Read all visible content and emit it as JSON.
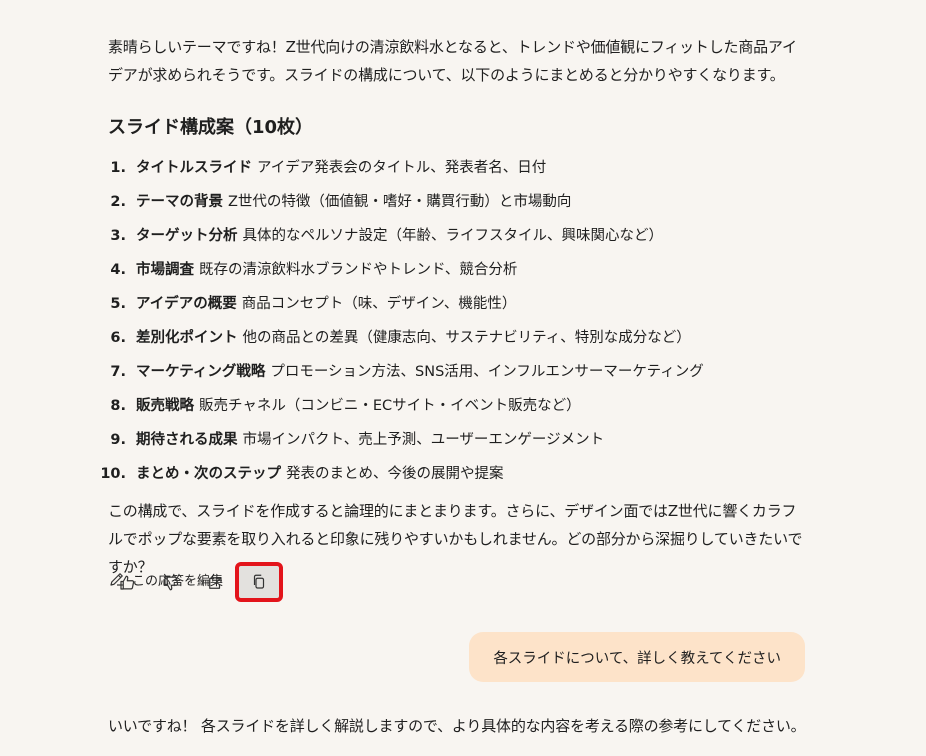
{
  "assistant_message": {
    "intro": "素晴らしいテーマですね！Z世代向けの清涼飲料水となると、トレンドや価値観にフィットした商品アイデアが求められそうです。スライドの構成について、以下のようにまとめると分かりやすくなります。",
    "heading": "スライド構成案（10枚）",
    "slides": [
      {
        "num": "1.",
        "title": "タイトルスライド",
        "desc": "アイデア発表会のタイトル、発表者名、日付"
      },
      {
        "num": "2.",
        "title": "テーマの背景",
        "desc": "Z世代の特徴（価値観・嗜好・購買行動）と市場動向"
      },
      {
        "num": "3.",
        "title": "ターゲット分析",
        "desc": "具体的なペルソナ設定（年齢、ライフスタイル、興味関心など）"
      },
      {
        "num": "4.",
        "title": "市場調査",
        "desc": "既存の清涼飲料水ブランドやトレンド、競合分析"
      },
      {
        "num": "5.",
        "title": "アイデアの概要",
        "desc": "商品コンセプト（味、デザイン、機能性）"
      },
      {
        "num": "6.",
        "title": "差別化ポイント",
        "desc": "他の商品との差異（健康志向、サステナビリティ、特別な成分など）"
      },
      {
        "num": "7.",
        "title": "マーケティング戦略",
        "desc": "プロモーション方法、SNS活用、インフルエンサーマーケティング"
      },
      {
        "num": "8.",
        "title": "販売戦略",
        "desc": "販売チャネル（コンビニ・ECサイト・イベント販売など）"
      },
      {
        "num": "9.",
        "title": "期待される成果",
        "desc": "市場インパクト、売上予測、ユーザーエンゲージメント"
      },
      {
        "num": "10.",
        "title": "まとめ・次のステップ",
        "desc": "発表のまとめ、今後の展開や提案"
      }
    ],
    "outro": "この構成で、スライドを作成すると論理的にまとまります。さらに、デザイン面ではZ世代に響くカラフルでポップな要素を取り入れると印象に残りやすいかもしれません。どの部分から深掘りしていきたいですか？"
  },
  "actions": {
    "like_icon": "thumbs-up-icon",
    "dislike_icon": "thumbs-down-icon",
    "share_icon": "share-icon",
    "copy_icon": "copy-icon",
    "edit_icon": "edit-pencil-icon",
    "edit_label": "この応答を編集",
    "highlight_color": "#e3141b"
  },
  "user_message": {
    "text": "各スライドについて、詳しく教えてください",
    "bubble_color": "#fde3c9"
  },
  "assistant_reply": {
    "text": "いいですね！ 各スライドを詳しく解説しますので、より具体的な内容を考える際の参考にしてください。"
  }
}
